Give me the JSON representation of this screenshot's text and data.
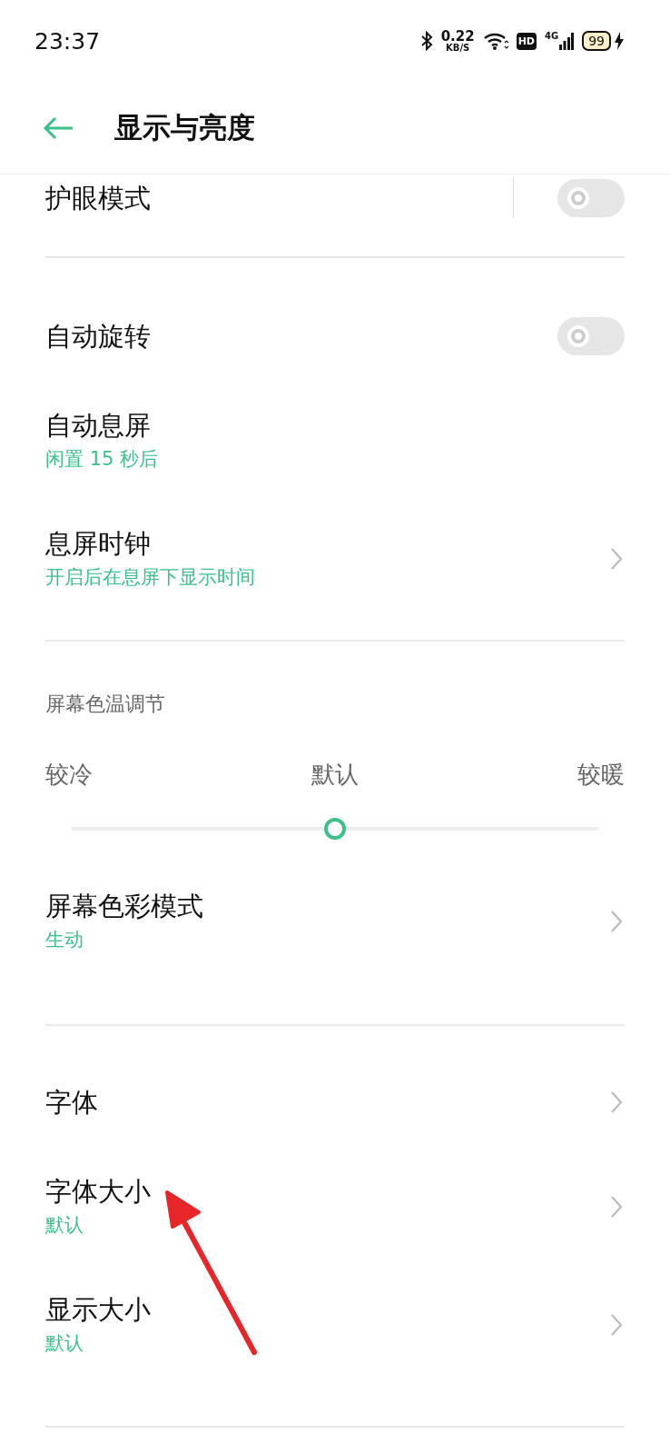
{
  "status_bar": {
    "time": "23:37",
    "net_speed": "0.22",
    "net_unit": "KB/S",
    "hd": "HD",
    "network": "4G",
    "battery": "99",
    "charging": true
  },
  "header": {
    "title": "显示与亮度"
  },
  "sections": [
    {
      "items": [
        {
          "kind": "toggle",
          "label": "护眼模式",
          "on": false,
          "divider": true
        }
      ]
    },
    {
      "items": [
        {
          "kind": "toggle",
          "label": "自动旋转",
          "on": false,
          "divider": false
        },
        {
          "kind": "value",
          "label": "自动息屏",
          "subtitle": "闲置 15 秒后"
        },
        {
          "kind": "link",
          "label": "息屏时钟",
          "subtitle": "开启后在息屏下显示时间"
        }
      ]
    },
    {
      "slider": {
        "title": "屏幕色温调节",
        "left": "较冷",
        "middle": "默认",
        "right": "较暖",
        "level": 0.5
      },
      "items": [
        {
          "kind": "link",
          "label": "屏幕色彩模式",
          "subtitle": "生动"
        }
      ]
    },
    {
      "items": [
        {
          "kind": "link",
          "label": "字体"
        },
        {
          "kind": "link",
          "label": "字体大小",
          "subtitle": "默认"
        },
        {
          "kind": "link",
          "label": "显示大小",
          "subtitle": "默认"
        }
      ]
    }
  ],
  "annotation": {
    "kind": "arrow",
    "color": "#e8262a"
  }
}
